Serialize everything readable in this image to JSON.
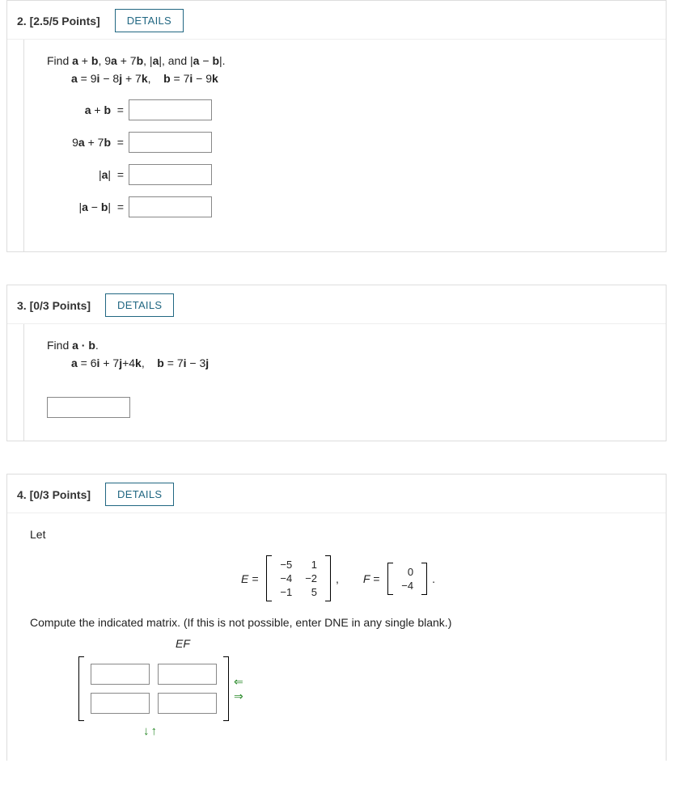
{
  "q2": {
    "header": "2.  [2.5/5 Points]",
    "details": "DETAILS",
    "prompt_html": "Find <b>a</b> + <b>b</b>, 9<b>a</b> + 7<b>b</b>, |<b>a</b>|, and |<b>a</b> − <b>b</b>|.",
    "given_html": "<b>a</b> = 9<b>i</b> − 8<b>j</b> + 7<b>k</b>, &nbsp;&nbsp; <b>b</b> = 7<b>i</b> − 9<b>k</b>",
    "rows": [
      {
        "label_html": "<b>a</b> + <b>b</b>&nbsp; ="
      },
      {
        "label_html": "9<b>a</b> + 7<b>b</b>&nbsp; ="
      },
      {
        "label_html": "|<b>a</b>|&nbsp; ="
      },
      {
        "label_html": "|<b>a</b> − <b>b</b>|&nbsp; ="
      }
    ]
  },
  "q3": {
    "header": "3.  [0/3 Points]",
    "details": "DETAILS",
    "prompt_html": "Find <b>a · b</b>.",
    "given_html": "<b>a</b> = 6<b>i</b> + 7<b>j</b>+4<b>k</b>, &nbsp;&nbsp; <b>b</b> = 7<b>i</b> − 3<b>j</b>"
  },
  "q4": {
    "header": "4.  [0/3 Points]",
    "details": "DETAILS",
    "let": "Let",
    "E_label": "E =",
    "F_label": "F =",
    "E": [
      [
        "−5",
        "1"
      ],
      [
        "−4",
        "−2"
      ],
      [
        "−1",
        "5"
      ]
    ],
    "F": [
      [
        "0"
      ],
      [
        "−4"
      ]
    ],
    "comma": ",",
    "period": ".",
    "instr": "Compute the indicated matrix. (If this is not possible, enter DNE in any single blank.)",
    "result_label": "EF",
    "arrows": {
      "left": "⇐",
      "right": "⇒",
      "down": "↓",
      "up": "↑"
    }
  }
}
